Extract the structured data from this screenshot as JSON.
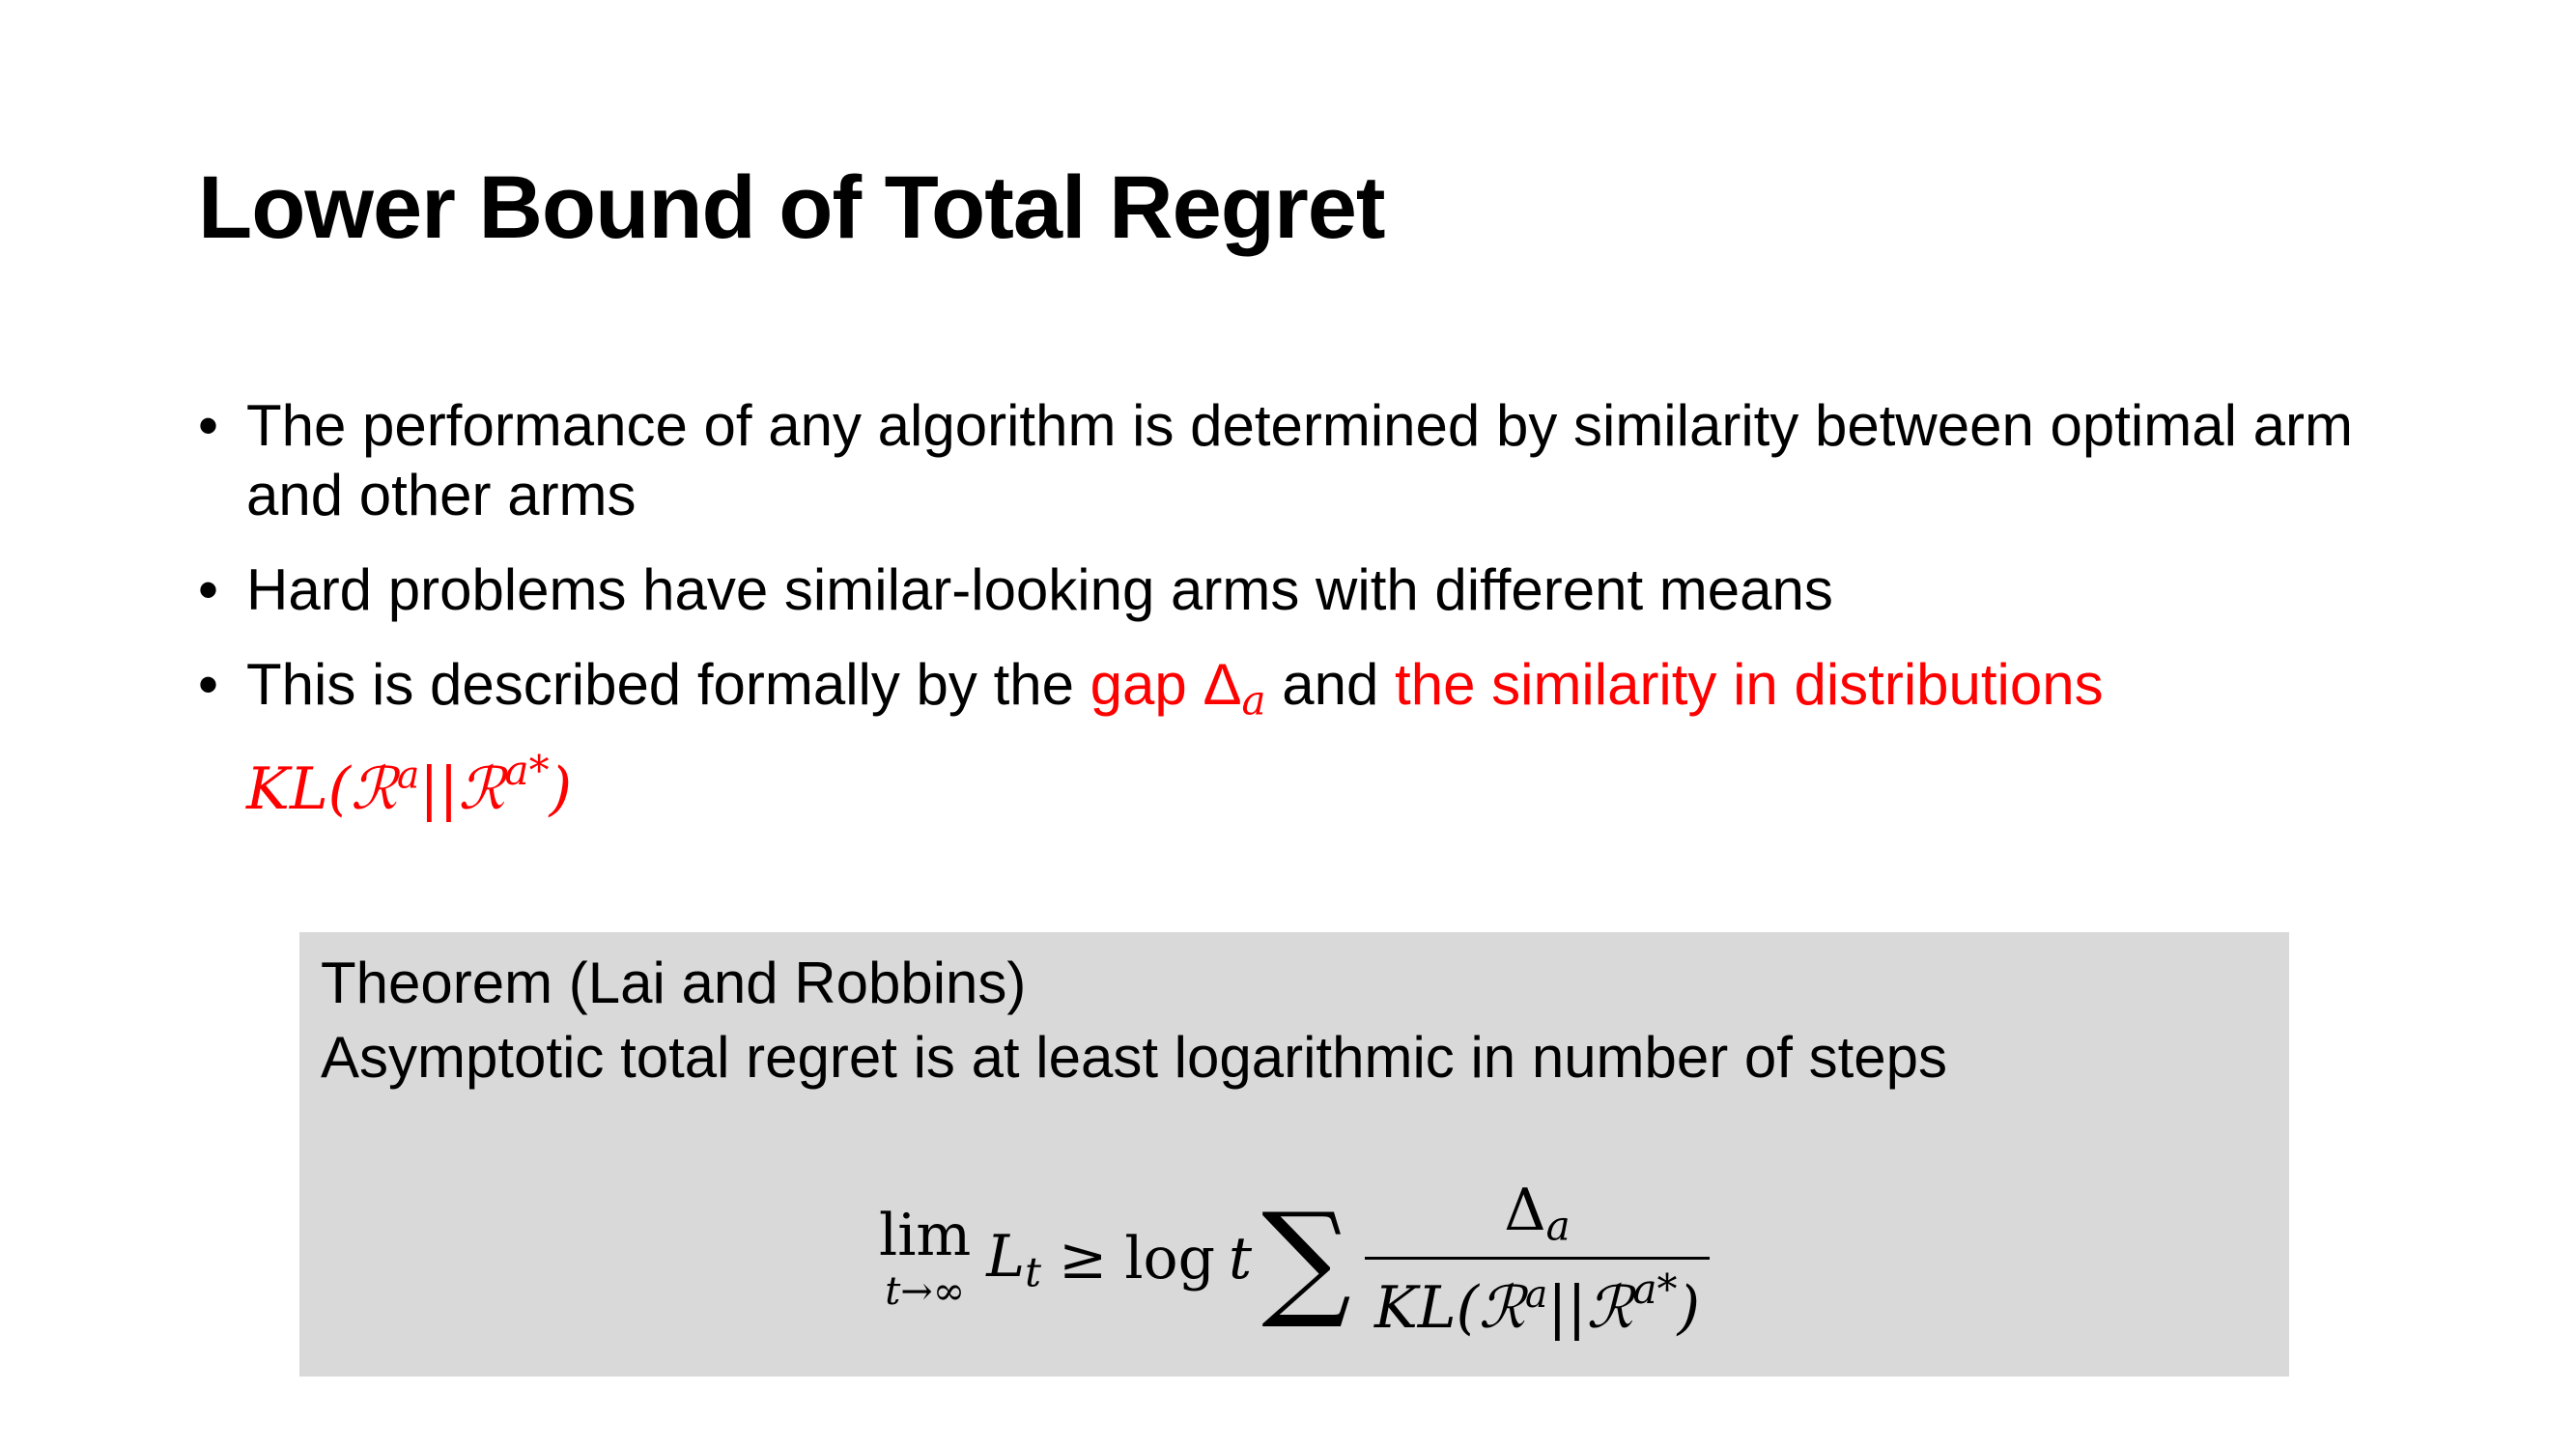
{
  "slide": {
    "title": "Lower Bound of Total Regret",
    "bullets": [
      {
        "text": "The performance of any algorithm is determined by similarity between optimal arm and other arms"
      },
      {
        "text": "Hard problems have similar-looking arms with different means"
      },
      {
        "prefix": "This is described formally by the ",
        "gap_label": "gap ",
        "gap_symbol": "Δ",
        "gap_sub": "a",
        "middle": " and ",
        "similarity_label": "the similarity in distributions",
        "kl": {
          "prefix": "KL(",
          "r1": "ℛ",
          "r1_sup": "a",
          "sep": "||",
          "r2": "ℛ",
          "r2_sup": "a*",
          "close": ")"
        }
      }
    ],
    "bullet_glyph": "•",
    "theorem": {
      "heading": "Theorem (Lai and Robbins)",
      "statement": "Asymptotic total regret is at least logarithmic in number of steps",
      "formula": {
        "lim": "lim",
        "lim_under": "t→∞",
        "L": "L",
        "L_sub": "t",
        "geq": "≥",
        "log": "log",
        "t": "t",
        "sum": "∑",
        "numerator": "Δ",
        "numerator_sub": "a",
        "denominator": "KL(ℛ",
        "den_sup1": "a",
        "den_mid": "||ℛ",
        "den_sup2": "a*",
        "den_close": ")"
      }
    },
    "colors": {
      "highlight": "#ff0000",
      "theorem_bg": "#d9d9d9",
      "text": "#000000"
    }
  }
}
